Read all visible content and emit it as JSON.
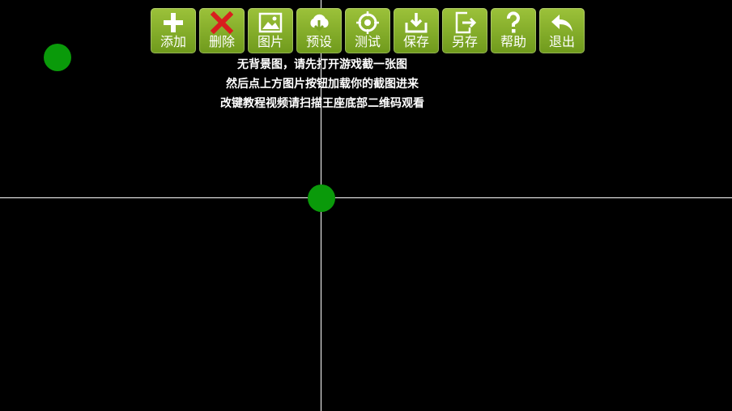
{
  "toolbar": {
    "buttons": [
      {
        "label": "添加",
        "icon": "plus-icon"
      },
      {
        "label": "删除",
        "icon": "close-icon"
      },
      {
        "label": "图片",
        "icon": "image-icon"
      },
      {
        "label": "预设",
        "icon": "cloud-download-icon"
      },
      {
        "label": "测试",
        "icon": "target-icon"
      },
      {
        "label": "保存",
        "icon": "save-tray-icon"
      },
      {
        "label": "另存",
        "icon": "export-icon"
      },
      {
        "label": "帮助",
        "icon": "question-icon"
      },
      {
        "label": "退出",
        "icon": "back-arrow-icon"
      }
    ]
  },
  "hint": {
    "line1": "无背景图，请先打开游戏截一张图",
    "line2": "然后点上方图片按钮加载你的截图进来",
    "line3": "改键教程视频请扫描王座底部二维码观看"
  },
  "colors": {
    "button_bg": "#8bb52e",
    "delete_icon": "#d81e1e",
    "marker": "#0a9a0a",
    "crosshair": "#ffffff",
    "background": "#000000"
  }
}
